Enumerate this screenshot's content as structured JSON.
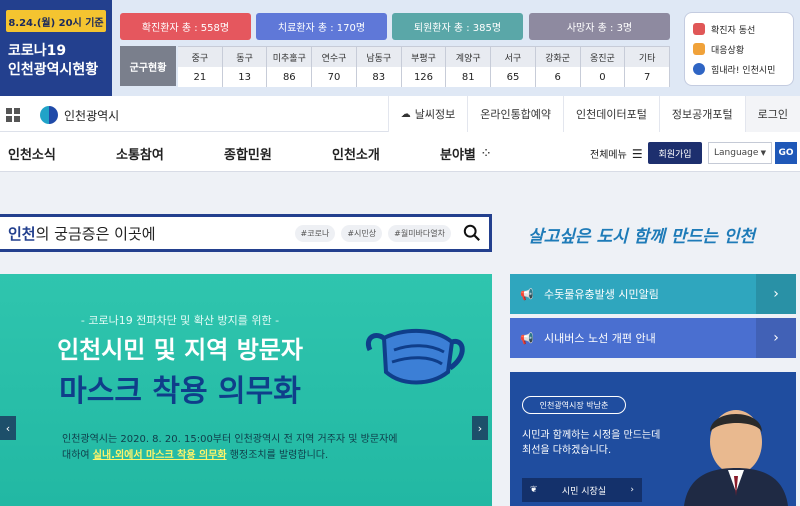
{
  "covid": {
    "date_badge": "8.24.(월) 20시 기준",
    "title": "코로나19\n인천광역시현황",
    "stats": [
      {
        "label": "확진환자 총 : 558명",
        "color": "#e5575e"
      },
      {
        "label": "치료환자 총 : 170명",
        "color": "#5f78d8"
      },
      {
        "label": "퇴원환자 총 : 385명",
        "color": "#5aa7a8"
      },
      {
        "label": "사망자 총 : 3명",
        "color": "#8e8aa0"
      }
    ],
    "gu_label": "군구현황",
    "districts": [
      {
        "name": "중구",
        "value": "21"
      },
      {
        "name": "동구",
        "value": "13"
      },
      {
        "name": "미추홀구",
        "value": "86"
      },
      {
        "name": "연수구",
        "value": "70"
      },
      {
        "name": "남동구",
        "value": "83"
      },
      {
        "name": "부평구",
        "value": "126"
      },
      {
        "name": "계양구",
        "value": "81"
      },
      {
        "name": "서구",
        "value": "65"
      },
      {
        "name": "강화군",
        "value": "6"
      },
      {
        "name": "옹진군",
        "value": "0"
      },
      {
        "name": "기타",
        "value": "7"
      }
    ],
    "links": [
      {
        "label": "확진자 동선",
        "icon": "pin-icon",
        "color": "#e05757"
      },
      {
        "label": "대응상황",
        "icon": "alert-icon",
        "color": "#f0a23a"
      },
      {
        "label": "힘내라! 인천시민",
        "icon": "heart-icon",
        "color": "#2f65c4"
      }
    ]
  },
  "topbar": {
    "logo": "인천광역시",
    "utilities": [
      {
        "label": "날씨정보",
        "icon": "weather-icon"
      },
      {
        "label": "온라인통합예약"
      },
      {
        "label": "인천데이터포털"
      },
      {
        "label": "정보공개포털"
      },
      {
        "label": "로그인"
      }
    ]
  },
  "gnb": {
    "items": [
      "인천소식",
      "소통참여",
      "종합민원",
      "인천소개",
      "분야별"
    ],
    "all_menu": "전체메뉴",
    "join": "회원가입",
    "language": "Language",
    "go": "GO"
  },
  "search": {
    "highlight": "인천",
    "text": "의 궁금증은 이곳에",
    "tags": [
      "#코로나",
      "#시민상",
      "#월미바다열차"
    ]
  },
  "slogan": "살고싶은 도시 함께 만드는 인천",
  "banner": {
    "pre": "- 코로나19 전파차단 및 확산 방지를 위한 -",
    "line1": "인천시민 및 지역 방문자",
    "line2": "마스크 착용 의무화",
    "desc1": "인천광역시는 2020. 8. 20. 15:00부터 인천광역시 전 지역 거주자 및 방문자에",
    "desc2_pre": "대하여 ",
    "desc2_hl": "실내.외에서 마스크 착용 의무화",
    "desc2_post": " 행정조치를 발령합니다.",
    "prev": "‹",
    "next": "›"
  },
  "notices": [
    {
      "label": "수돗물유충발생 시민알림"
    },
    {
      "label": "시내버스 노선 개편 안내"
    }
  ],
  "mayor": {
    "tag": "인천광역시장 박남춘",
    "msg1": "시민과 함께하는 시정을 만드는데",
    "msg2": "최선을 다하겠습니다.",
    "button": "시민 시장실"
  }
}
